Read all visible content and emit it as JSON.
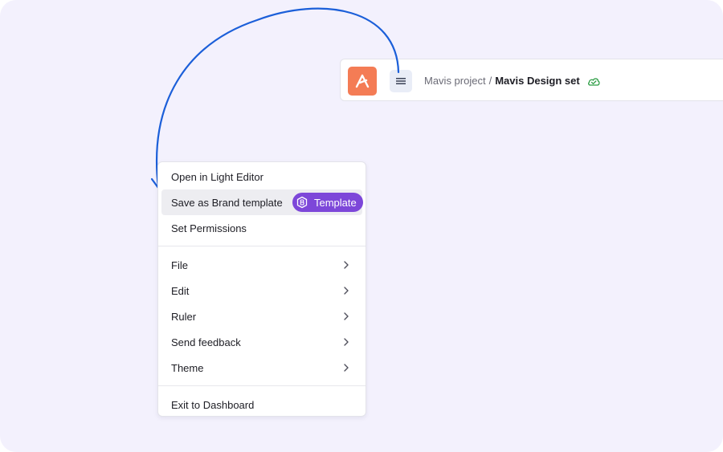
{
  "header": {
    "logo_icon": "mavis-logo-icon",
    "menu_icon": "hamburger-icon",
    "project": "Mavis project",
    "separator": "/",
    "file": "Mavis Design set",
    "status_icon": "cloud-check-icon",
    "status_color": "#2e9e46"
  },
  "menu": {
    "open_light_editor": "Open in Light Editor",
    "save_brand_template": "Save as Brand template",
    "template_badge": "Template",
    "set_permissions": "Set Permissions",
    "file": "File",
    "edit": "Edit",
    "ruler": "Ruler",
    "send_feedback": "Send feedback",
    "theme": "Theme",
    "exit_dashboard": "Exit to Dashboard"
  },
  "colors": {
    "background": "#f3f1fd",
    "logo": "#f47c55",
    "badge": "#7d47d9",
    "arrow": "#1b5fd9"
  }
}
